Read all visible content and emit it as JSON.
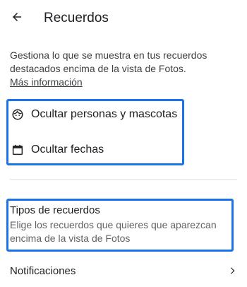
{
  "header": {
    "title": "Recuerdos",
    "back_icon": "arrow-left-icon"
  },
  "intro": {
    "text": "Gestiona lo que se muestra en tus recuerdos destacados encima de la vista de Fotos.",
    "link": "Más información"
  },
  "options": {
    "people": {
      "label": "Ocultar personas y mascotas",
      "icon": "face-icon"
    },
    "dates": {
      "label": "Ocultar fechas",
      "icon": "calendar-icon"
    }
  },
  "memory_types": {
    "title": "Tipos de recuerdos",
    "description": "Elige los recuerdos que quieres que aparezcan encima de la vista de Fotos"
  },
  "notifications": {
    "label": "Notificaciones",
    "icon": "chevron-right-icon"
  },
  "colors": {
    "highlight": "#1a73e8",
    "text_primary": "#202124",
    "text_secondary": "#5f6368"
  }
}
